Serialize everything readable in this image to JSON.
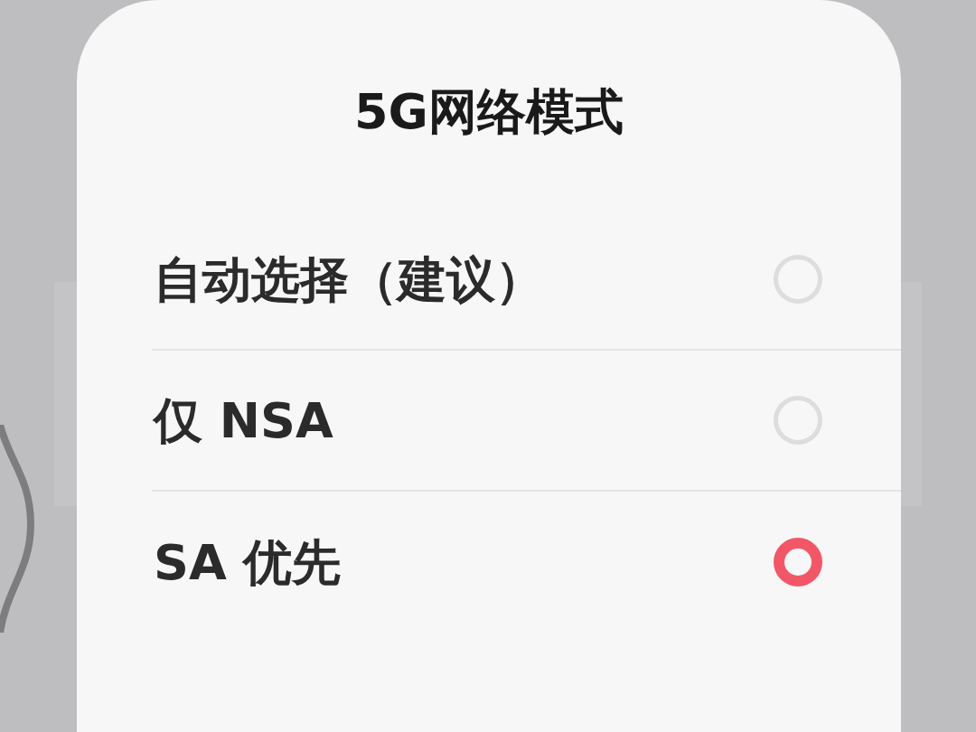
{
  "dialog": {
    "title": "5G网络模式",
    "options": [
      {
        "label": "自动选择（建议）",
        "selected": false
      },
      {
        "label": "仅 NSA",
        "selected": false
      },
      {
        "label": "SA 优先",
        "selected": true
      }
    ]
  }
}
